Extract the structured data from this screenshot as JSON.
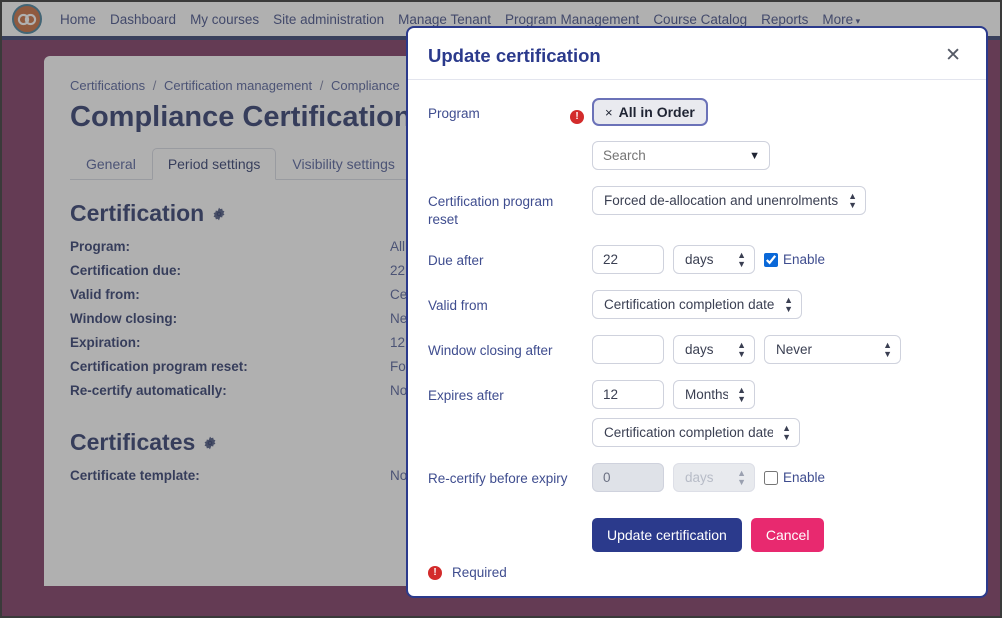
{
  "navbar": {
    "logo_icon": "infinity-logo-icon",
    "links": [
      "Home",
      "Dashboard",
      "My courses",
      "Site administration",
      "Manage Tenant",
      "Program Management",
      "Course Catalog",
      "Reports"
    ],
    "more_label": "More"
  },
  "page": {
    "breadcrumb": [
      "Certifications",
      "Certification management",
      "Compliance"
    ],
    "title": "Compliance Certification",
    "tabs": [
      {
        "label": "General",
        "active": false
      },
      {
        "label": "Period settings",
        "active": true
      },
      {
        "label": "Visibility settings",
        "active": false
      }
    ],
    "sections": [
      {
        "heading": "Certification",
        "gear_icon": "gear-icon",
        "rows": [
          {
            "key": "Program:",
            "value": "All i"
          },
          {
            "key": "Certification due:",
            "value": "22 "
          },
          {
            "key": "Valid from:",
            "value": "Cer"
          },
          {
            "key": "Window closing:",
            "value": "Nev"
          },
          {
            "key": "Expiration:",
            "value": "12 "
          },
          {
            "key": "Certification program reset:",
            "value": "For"
          },
          {
            "key": "Re-certify automatically:",
            "value": "No"
          }
        ]
      },
      {
        "heading": "Certificates",
        "gear_icon": "gear-icon",
        "rows": [
          {
            "key": "Certificate template:",
            "value": "No"
          }
        ]
      }
    ]
  },
  "modal": {
    "title": "Update certification",
    "close_icon": "close-icon",
    "fields": {
      "program": {
        "label": "Program",
        "required_icon": "required-exclamation-icon",
        "chip_remove": "×",
        "chip_label": "All in Order",
        "search_placeholder": "Search",
        "search_value": "",
        "caret_icon": "caret-down-icon"
      },
      "reset": {
        "label": "Certification program reset",
        "value": "Forced de-allocation and unenrolments"
      },
      "due_after": {
        "label": "Due after",
        "amount": "22",
        "unit": "days",
        "enable_label": "Enable",
        "enabled": true
      },
      "valid_from": {
        "label": "Valid from",
        "value": "Certification completion date"
      },
      "window_closing": {
        "label": "Window closing after",
        "amount": "",
        "unit": "days",
        "anchor": "Never"
      },
      "expires_after": {
        "label": "Expires after",
        "amount": "12",
        "unit": "Months",
        "anchor": "Certification completion date"
      },
      "recertify": {
        "label": "Re-certify before expiry",
        "amount": "0",
        "unit": "days",
        "enable_label": "Enable",
        "enabled": false
      }
    },
    "buttons": {
      "submit": "Update certification",
      "cancel": "Cancel"
    },
    "footer": {
      "required_icon": "required-exclamation-icon",
      "required_label": "Required"
    }
  },
  "colors": {
    "brand_maroon": "#6d2050",
    "nav_underline": "#1b2a5e",
    "modal_border": "#2b3a8c",
    "primary_button": "#2b3a8c",
    "cancel_button": "#e8296f",
    "required_red": "#d32b2b",
    "link_blue": "#3f4d8f"
  }
}
